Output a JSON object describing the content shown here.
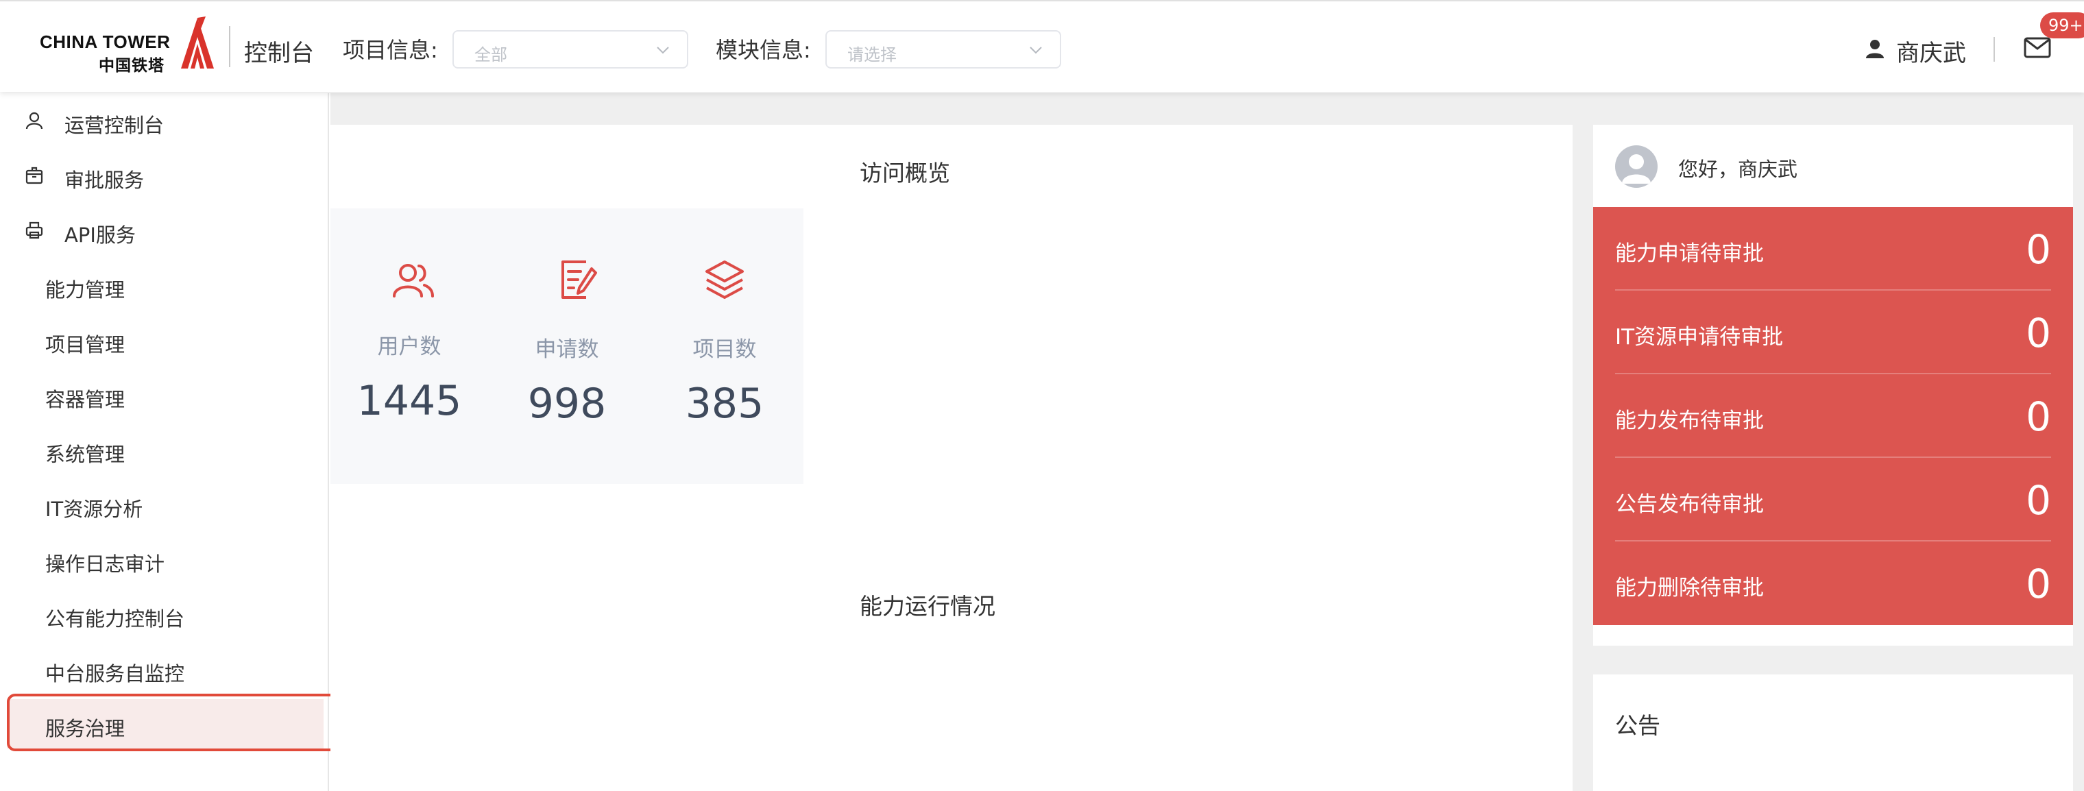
{
  "header": {
    "logo_en": "CHINA TOWER",
    "logo_cn": "中国铁塔",
    "console_title": "控制台",
    "project_filter": {
      "label": "项目信息:",
      "placeholder": "全部"
    },
    "module_filter": {
      "label": "模块信息:",
      "placeholder": "请选择"
    },
    "user_name": "商庆武",
    "mail_badge": "99+",
    "icons": [
      "logo-tower-mark",
      "chevron-down-icon",
      "user-icon",
      "mail-icon"
    ]
  },
  "sidebar": {
    "items": [
      {
        "label": "运营控制台",
        "icon": "user-icon"
      },
      {
        "label": "审批服务",
        "icon": "box-icon"
      },
      {
        "label": "API服务",
        "icon": "printer-icon"
      },
      {
        "label": "能力管理"
      },
      {
        "label": "项目管理"
      },
      {
        "label": "容器管理"
      },
      {
        "label": "系统管理"
      },
      {
        "label": "IT资源分析"
      },
      {
        "label": "操作日志审计"
      },
      {
        "label": "公有能力控制台"
      },
      {
        "label": "中台服务自监控"
      },
      {
        "label": "服务治理",
        "active": true
      }
    ]
  },
  "main": {
    "overview_title": "访问概览",
    "stats": [
      {
        "label": "用户数",
        "value": "1445",
        "icon": "users-icon"
      },
      {
        "label": "申请数",
        "value": "998",
        "icon": "edit-document-icon"
      },
      {
        "label": "项目数",
        "value": "385",
        "icon": "layers-icon"
      }
    ],
    "capability_title": "能力运行情况",
    "greeting": "您好，商庆武",
    "pending": [
      {
        "label": "能力申请待审批",
        "value": "0"
      },
      {
        "label": "IT资源申请待审批",
        "value": "0"
      },
      {
        "label": "能力发布待审批",
        "value": "0"
      },
      {
        "label": "公告发布待审批",
        "value": "0"
      },
      {
        "label": "能力删除待审批",
        "value": "0"
      }
    ],
    "notice_title": "公告"
  },
  "colors": {
    "accent": "#dc4b46",
    "pending_bg": "#dc5550",
    "highlight": "#e14a3a",
    "active_bg": "#f8ebea"
  }
}
